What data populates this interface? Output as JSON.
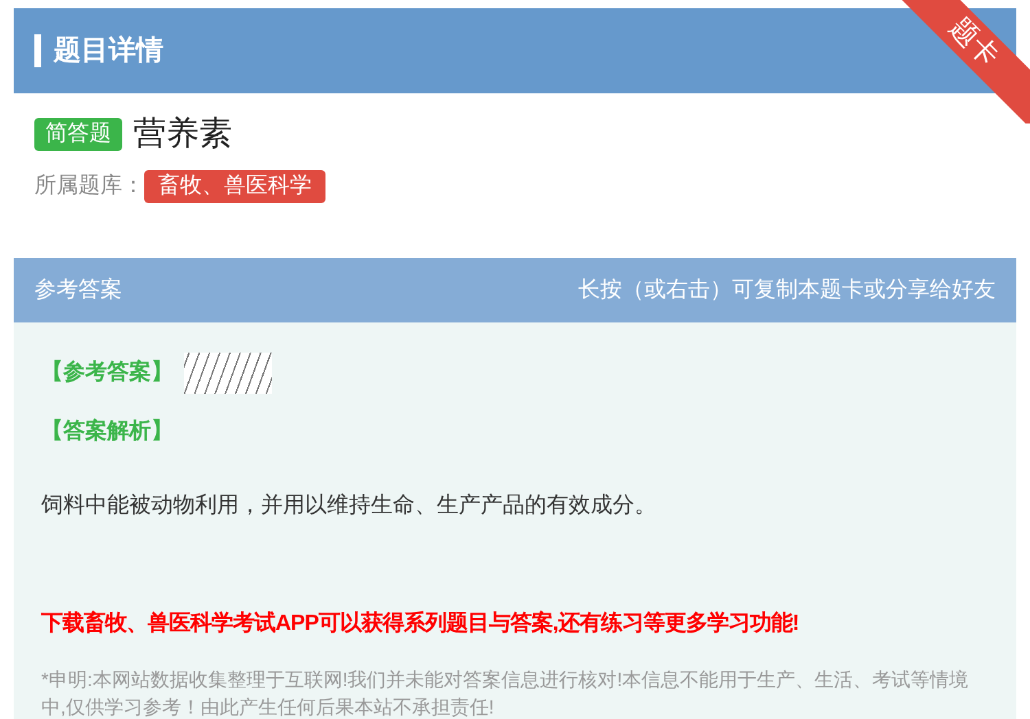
{
  "header": {
    "title": "题目详情",
    "ribbon": "题卡"
  },
  "question": {
    "type_badge": "简答题",
    "title": "营养素",
    "bank_label": "所属题库：",
    "bank": "畜牧、兽医科学"
  },
  "answer_panel": {
    "title": "参考答案",
    "hint": "长按（或右击）可复制本题卡或分享给好友",
    "answer_label": "【参考答案】",
    "analysis_label": "【答案解析】",
    "analysis": "饲料中能被动物利用，并用以维持生命、生产产品的有效成分。",
    "promo": "下载畜牧、兽医科学考试APP可以获得系列题目与答案,还有练习等更多学习功能!",
    "disclaimer": "*申明:本网站数据收集整理于互联网!我们并未能对答案信息进行核对!本信息不能用于生产、生活、考试等情境中,仅供学习参考！由此产生任何后果本站不承担责任!"
  }
}
